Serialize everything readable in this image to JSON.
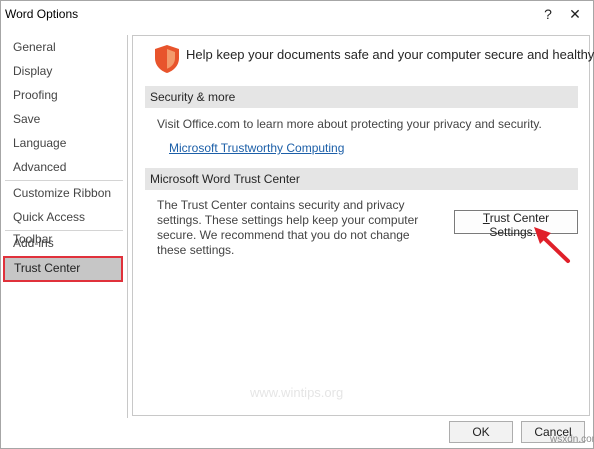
{
  "window": {
    "title": "Word Options",
    "help_label": "?",
    "close_label": "✕"
  },
  "sidebar": {
    "items": [
      {
        "label": "General"
      },
      {
        "label": "Display"
      },
      {
        "label": "Proofing"
      },
      {
        "label": "Save"
      },
      {
        "label": "Language"
      },
      {
        "label": "Advanced"
      },
      {
        "label": "Customize Ribbon"
      },
      {
        "label": "Quick Access Toolbar"
      },
      {
        "label": "Add-ins"
      },
      {
        "label": "Trust Center"
      }
    ],
    "selected": "Trust Center"
  },
  "main": {
    "intro": "Help keep your documents safe and your computer secure and healthy.",
    "security_section": {
      "header": "Security & more",
      "text": "Visit Office.com to learn more about protecting your privacy and security.",
      "link": "Microsoft Trustworthy Computing"
    },
    "trust_section": {
      "header": "Microsoft Word Trust Center",
      "description": "The Trust Center contains security and privacy settings. These settings help keep your computer secure. We recommend that you do not change these settings.",
      "button_hotkey": "T",
      "button_rest": "rust Center Settings..."
    }
  },
  "footer": {
    "ok_label": "OK",
    "cancel_label": "Cancel"
  },
  "watermark": "www.wintips.org",
  "corner_mark": "wsxdn.com",
  "colors": {
    "selection_outline": "#e0313b",
    "shield": "#e8542c",
    "arrow": "#e0202a",
    "link": "#1c5fa8"
  },
  "icons": {
    "shield": "shield-icon",
    "arrow": "red-arrow-annotation"
  }
}
